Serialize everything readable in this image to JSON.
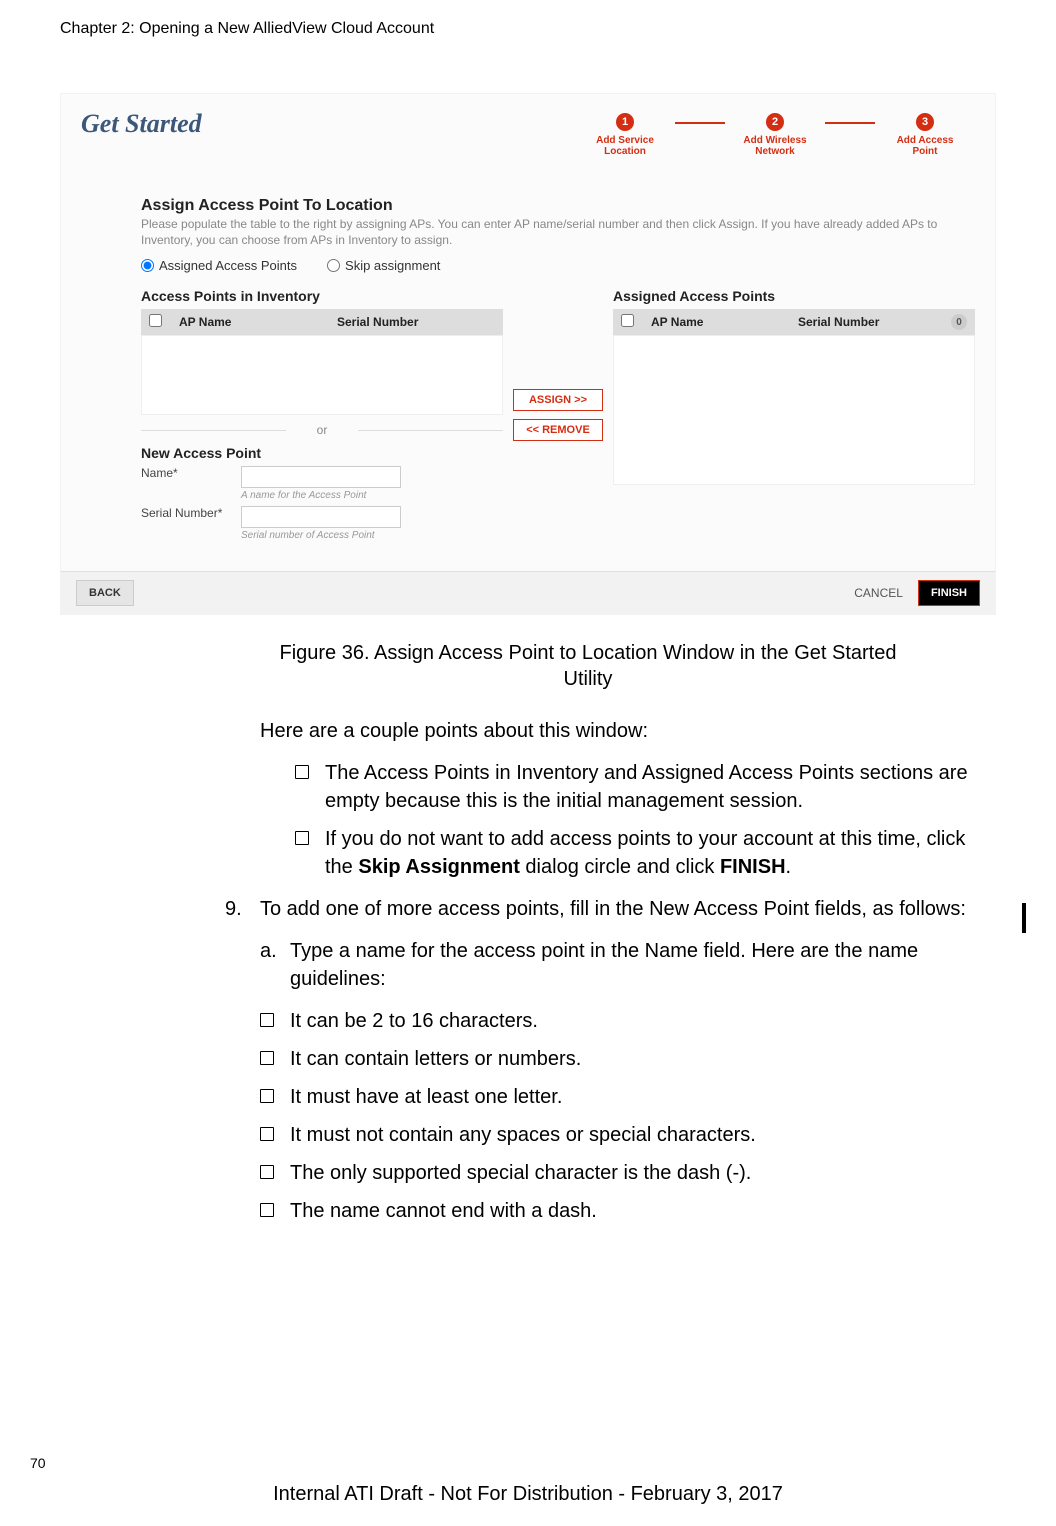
{
  "chapter_header": "Chapter 2: Opening a New AlliedView Cloud Account",
  "figure": {
    "title": "Get Started",
    "stepper": {
      "steps": [
        {
          "num": "1",
          "label1": "Add Service",
          "label2": "Location"
        },
        {
          "num": "2",
          "label1": "Add Wireless",
          "label2": "Network"
        },
        {
          "num": "3",
          "label1": "Add Access",
          "label2": "Point"
        }
      ]
    },
    "assign": {
      "header": "Assign Access Point To Location",
      "desc": "Please populate the table to the right by assigning APs. You can enter AP name/serial number and then click Assign. If you have already added APs to Inventory, you can choose from APs in Inventory to assign.",
      "radio_assigned": "Assigned Access Points",
      "radio_skip": "Skip assignment"
    },
    "left": {
      "title": "Access Points in Inventory",
      "col_ap": "AP Name",
      "col_sn": "Serial Number",
      "or": "or",
      "new_title": "New Access Point",
      "name_lbl": "Name*",
      "name_hint": "A name for the Access Point",
      "sn_lbl": "Serial Number*",
      "sn_hint": "Serial number of Access Point"
    },
    "mid": {
      "assign_btn": "ASSIGN >>",
      "remove_btn": "<< REMOVE"
    },
    "right": {
      "title": "Assigned Access Points",
      "col_ap": "AP Name",
      "col_sn": "Serial Number",
      "count": "0"
    },
    "footer": {
      "back": "BACK",
      "cancel": "CANCEL",
      "finish": "FINISH"
    }
  },
  "caption": "Figure 36. Assign Access Point to Location Window in the Get Started Utility",
  "intro": "Here are a couple points about this window:",
  "bullets_a": [
    "The Access Points in Inventory and Assigned Access Points sections are empty because this is the initial management session."
  ],
  "bullet_b_pre": "If you do not want to add access points to your account at this time, click the ",
  "bullet_b_bold1": "Skip Assignment",
  "bullet_b_mid": " dialog circle and click ",
  "bullet_b_bold2": "FINISH",
  "bullet_b_post": ".",
  "step9_num": "9.",
  "step9_text": "To add one of more access points, fill in the New Access Point fields, as follows:",
  "step9a_lt": "a.",
  "step9a_text": "Type a name for the access point in the Name field. Here are the name guidelines:",
  "guidelines": [
    "It can be 2 to 16 characters.",
    "It can contain letters or numbers.",
    "It must have at least one letter.",
    "It must not contain any spaces or special characters.",
    "The only supported special character is the dash (-).",
    "The name cannot end with a dash."
  ],
  "page_number": "70",
  "footer_line": "Internal ATI Draft - Not For Distribution - February 3, 2017"
}
